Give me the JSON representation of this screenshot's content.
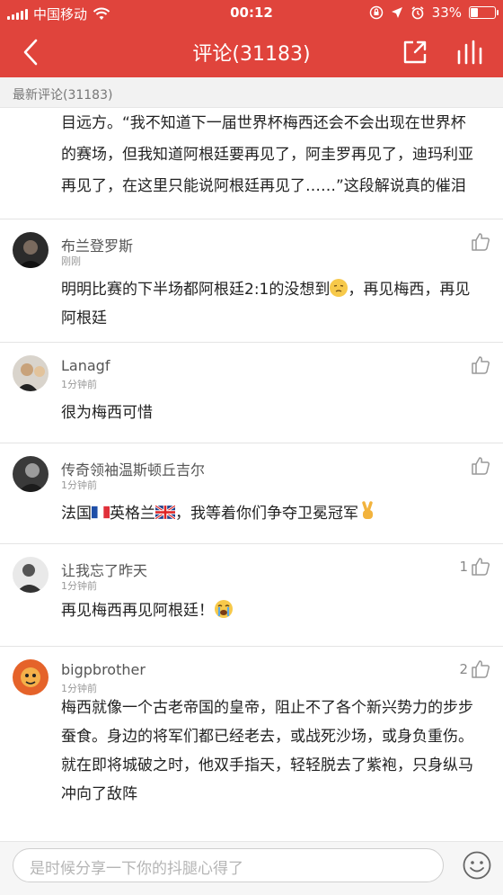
{
  "status_bar": {
    "carrier": "中国移动",
    "time": "00:12",
    "battery_percent": "33%",
    "battery_level": 0.33,
    "icons": [
      "signal-icon",
      "wifi-icon",
      "orientation-lock-icon",
      "location-icon",
      "alarm-icon",
      "battery-icon"
    ]
  },
  "nav": {
    "title": "评论(31183)",
    "back_icon": "chevron-left-icon",
    "share_icon": "share-icon",
    "stats_icon": "bar-chart-icon"
  },
  "section": {
    "label": "最新评论(31183)"
  },
  "partial_comment": {
    "text": "目远方。“我不知道下一届世界杯梅西还会不会出现在世界杯的赛场，但我知道阿根廷要再见了，阿圭罗再见了，迪玛利亚再见了，在这里只能说阿根廷再见了……”这段解说真的催泪"
  },
  "comments": [
    {
      "name": "布兰登罗斯",
      "time": "刚刚",
      "likes": "",
      "text_before": "明明比赛的下半场都阿根廷2:1的没想到",
      "emoji": "disappointed-face",
      "text_after": "，再见梅西，再见阿根廷"
    },
    {
      "name": "Lanagf",
      "time": "1分钟前",
      "likes": "",
      "text": "很为梅西可惜"
    },
    {
      "name": "传奇领袖温斯顿丘吉尔",
      "time": "1分钟前",
      "likes": "",
      "text_a": "法国",
      "flag_a": "france-flag",
      "text_b": "英格兰",
      "flag_b": "uk-flag",
      "text_c": "，我等着你们争夺卫冕冠军",
      "emoji": "victory-hand"
    },
    {
      "name": "让我忘了昨天",
      "time": "1分钟前",
      "likes": "1",
      "text": "再见梅西再见阿根廷！",
      "emoji": "loudly-crying-face"
    },
    {
      "name": "bigpbrother",
      "time": "1分钟前",
      "likes": "2",
      "text": "梅西就像一个古老帝国的皇帝，阻止不了各个新兴势力的步步蚕食。身边的将军们都已经老去，或战死沙场，或身负重伤。就在即将城破之时，他双手指天，轻轻脱去了紫袍，只身纵马冲向了敌阵"
    }
  ],
  "input": {
    "placeholder": "是时候分享一下你的抖腿心得了",
    "emoji_icon": "smiley-face-icon"
  },
  "colors": {
    "header": "#e0443c",
    "section_bg": "#f2f2f2",
    "text": "#222222",
    "meta": "#999999"
  }
}
